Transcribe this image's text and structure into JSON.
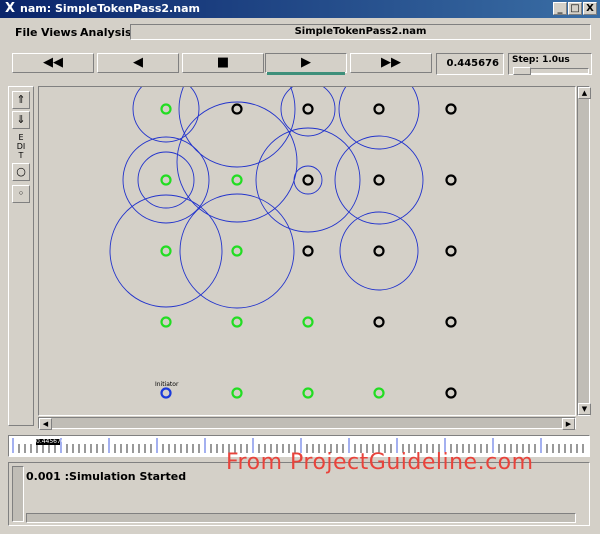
{
  "window": {
    "title": "nam: SimpleTokenPass2.nam",
    "minimize": "_",
    "maximize": "□",
    "close": "X"
  },
  "menu": {
    "file": "File",
    "views": "Views",
    "analysis": "Analysis"
  },
  "filename": "SimpleTokenPass2.nam",
  "transport": {
    "rewind": "◀◀",
    "back": "◀",
    "stop": "■",
    "play": "▶",
    "fast_forward": "▶▶"
  },
  "time": "0.445676",
  "step": "Step: 1.0us",
  "toolbar": {
    "edit": "EDIT"
  },
  "initiator_label": "Initiator",
  "output": {
    "message": "0.001 :Simulation Started"
  },
  "watermark": "From ProjectGuideline.com",
  "timeline_marker": "0.445676",
  "colors": {
    "active_node": "#22dd22",
    "idle_node": "#000000",
    "initiator_node": "#1a3adb",
    "range_circle": "#2233cc"
  },
  "nodes": [
    {
      "id": "n0",
      "row": 0,
      "col": 0,
      "state": "active"
    },
    {
      "id": "n1",
      "row": 0,
      "col": 1,
      "state": "idle"
    },
    {
      "id": "n2",
      "row": 0,
      "col": 2,
      "state": "idle"
    },
    {
      "id": "n3",
      "row": 0,
      "col": 3,
      "state": "idle"
    },
    {
      "id": "n4",
      "row": 0,
      "col": 4,
      "state": "idle"
    },
    {
      "id": "n5",
      "row": 1,
      "col": 0,
      "state": "active"
    },
    {
      "id": "n6",
      "row": 1,
      "col": 1,
      "state": "active"
    },
    {
      "id": "n7",
      "row": 1,
      "col": 2,
      "state": "idle"
    },
    {
      "id": "n8",
      "row": 1,
      "col": 3,
      "state": "idle"
    },
    {
      "id": "n9",
      "row": 1,
      "col": 4,
      "state": "idle"
    },
    {
      "id": "n10",
      "row": 2,
      "col": 0,
      "state": "active"
    },
    {
      "id": "n11",
      "row": 2,
      "col": 1,
      "state": "active"
    },
    {
      "id": "n12",
      "row": 2,
      "col": 2,
      "state": "idle"
    },
    {
      "id": "n13",
      "row": 2,
      "col": 3,
      "state": "idle"
    },
    {
      "id": "n14",
      "row": 2,
      "col": 4,
      "state": "idle"
    },
    {
      "id": "n15",
      "row": 3,
      "col": 0,
      "state": "active"
    },
    {
      "id": "n16",
      "row": 3,
      "col": 1,
      "state": "active"
    },
    {
      "id": "n17",
      "row": 3,
      "col": 2,
      "state": "active"
    },
    {
      "id": "n18",
      "row": 3,
      "col": 3,
      "state": "idle"
    },
    {
      "id": "n19",
      "row": 3,
      "col": 4,
      "state": "idle"
    },
    {
      "id": "n20",
      "row": 4,
      "col": 0,
      "state": "initiator"
    },
    {
      "id": "n21",
      "row": 4,
      "col": 1,
      "state": "active"
    },
    {
      "id": "n22",
      "row": 4,
      "col": 2,
      "state": "active"
    },
    {
      "id": "n23",
      "row": 4,
      "col": 3,
      "state": "active"
    },
    {
      "id": "n24",
      "row": 4,
      "col": 4,
      "state": "idle"
    }
  ]
}
